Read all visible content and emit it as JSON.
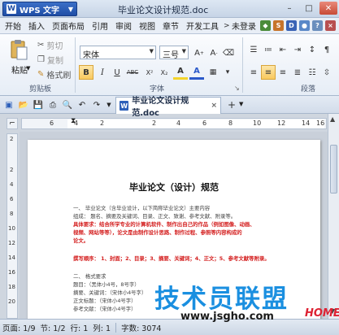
{
  "titlebar": {
    "app_button": "WPS 文字",
    "app_logo": "W",
    "title": "毕业论文设计规范.doc",
    "controls": [
      "–",
      "□",
      "✕"
    ]
  },
  "menu": {
    "items": [
      "开始",
      "插入",
      "页面布局",
      "引用",
      "审阅",
      "视图",
      "章节",
      "开发工具"
    ],
    "more": ">",
    "login": "未登录",
    "right_icons": [
      "S",
      "D"
    ]
  },
  "ribbon": {
    "paste": "粘贴",
    "cut": "剪切",
    "copy": "复制",
    "format_painter": "格式刷",
    "clipboard_label": "剪贴板",
    "font_name": "宋体",
    "font_size": "三号",
    "font_label": "字体",
    "paragraph_label": "段落",
    "bold": "B",
    "italic": "I",
    "underline": "U",
    "strike": "ABC",
    "sup": "X²",
    "sub": "X₂",
    "font_color": "A",
    "highlight": "A"
  },
  "tabs": {
    "doc_tab": "毕业论文设计规范.doc",
    "close": "×",
    "new": "+"
  },
  "ruler": {
    "marks": [
      "6",
      "4",
      "2",
      "",
      "2",
      "4",
      "6",
      "8",
      "10",
      "12",
      "14",
      "16"
    ]
  },
  "vruler": {
    "marks": [
      "2",
      "",
      "2",
      "4",
      "6",
      "8",
      "10",
      "12",
      "14",
      "16",
      "18",
      "20"
    ]
  },
  "document": {
    "title": "毕业论文（设计）规范",
    "lines": [
      {
        "text": "一、 毕业论文（含毕业设计，以下简称毕业论文）主要内容",
        "red": false
      },
      {
        "text": "    组成：  题名、摘要及关键词、目录、正文、致谢、参考文献、附录等。",
        "red": false
      },
      {
        "text": "          具体要求：结合所学专业的计算机软件、制作出自己的作品（例如图像、动画、",
        "red": true
      },
      {
        "text": "          视频、网站等等），论文是由制作设计思路、制作过程、参照等内容构成的",
        "red": true
      },
      {
        "text": "          论文。",
        "red": true
      },
      {
        "text": "",
        "red": false
      },
      {
        "text": "    撰写顺序：  1、封面；2、目录；3、摘要、关键词；4、正文；5、参考文献等附录。",
        "red": true
      },
      {
        "text": "",
        "red": false
      },
      {
        "text": "二、 格式要求",
        "red": false
      },
      {
        "text": "    题目：（黑体小4号，8号字）",
        "red": false
      },
      {
        "text": "    摘要、关键词：（宋体小4号字）",
        "red": false
      },
      {
        "text": "    正文标题：（宋体小4号字）",
        "red": false
      },
      {
        "text": "    参考文献：（宋体小4号字）",
        "red": false
      }
    ]
  },
  "status": {
    "page": "页面: 1/9",
    "section": "节: 1/2",
    "row": "行: 1",
    "col": "列: 1",
    "words": "字数: 3074"
  },
  "watermark": {
    "brand": "技术员联盟",
    "url": "www.jsgho.com",
    "home": "HOME"
  }
}
